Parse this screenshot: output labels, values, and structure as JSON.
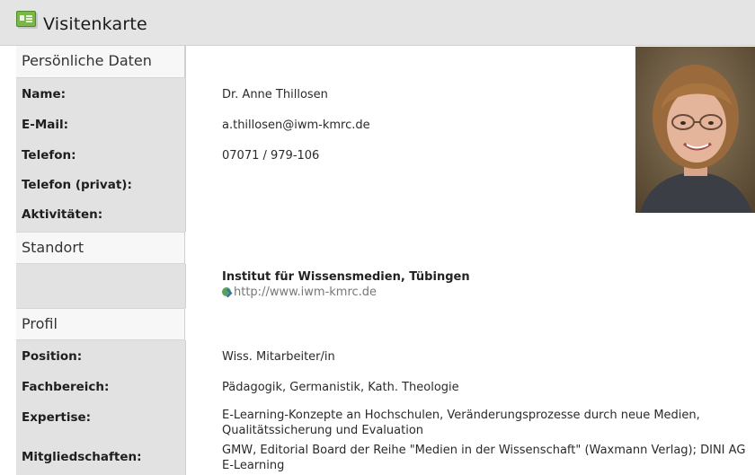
{
  "header": {
    "title": "Visitenkarte",
    "icon": "business-card-icon"
  },
  "personal": {
    "section_label": "Persönliche Daten",
    "name_label": "Name:",
    "name_value": "Dr. Anne Thillosen",
    "email_label": "E-Mail:",
    "email_value": "a.thillosen@iwm-kmrc.de",
    "phone_label": "Telefon:",
    "phone_value": "07071 / 979-106",
    "phone_private_label": "Telefon (privat):",
    "activities_label": "Aktivitäten:"
  },
  "location": {
    "section_label": "Standort",
    "institute_name": "Institut für Wissensmedien, Tübingen",
    "institute_url": "http://www.iwm-kmrc.de",
    "url_icon": "globe-link-icon"
  },
  "profile": {
    "section_label": "Profil",
    "position_label": "Position:",
    "position_value": "Wiss. Mitarbeiter/in",
    "department_label": "Fachbereich:",
    "department_value": "Pädagogik, Germanistik, Kath. Theologie",
    "expertise_label": "Expertise:",
    "expertise_value": "E-Learning-Konzepte an Hochschulen, Veränderungsprozesse durch neue Medien, Qualitätssicherung und Evaluation",
    "memberships_label": "Mitgliedschaften:",
    "memberships_value": "GMW, Editorial Board der Reihe \"Medien in der Wissenschaft\" (Waxmann Verlag); DINI AG E-Learning"
  },
  "colors": {
    "header_bg": "#e4e4e4",
    "label_column_bg": "#e2e2e2",
    "icon_green": "#7ab648"
  }
}
